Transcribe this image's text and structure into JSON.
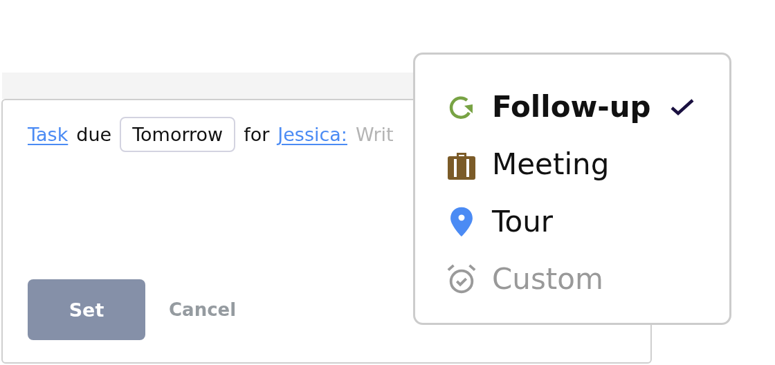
{
  "composer": {
    "sentence": [
      {
        "kind": "link",
        "text": "Task"
      },
      {
        "kind": "word",
        "text": "due"
      },
      {
        "kind": "field",
        "text": "Tomorrow"
      },
      {
        "kind": "word",
        "text": "for"
      },
      {
        "kind": "link",
        "text": "Jessica:"
      }
    ],
    "message": {
      "placeholder": "Writ"
    },
    "buttons": [
      {
        "kind": "primary",
        "label": "Set"
      },
      {
        "kind": "plain",
        "label": "Cancel"
      }
    ]
  },
  "menu": {
    "items": [
      {
        "kind": "follow-up",
        "label": "Follow-up",
        "selected": true,
        "disabled": false
      },
      {
        "kind": "meeting",
        "label": "Meeting",
        "selected": false,
        "disabled": false
      },
      {
        "kind": "tour",
        "label": "Tour",
        "selected": false,
        "disabled": false
      },
      {
        "kind": "custom",
        "label": "Custom",
        "selected": false,
        "disabled": true
      }
    ]
  }
}
